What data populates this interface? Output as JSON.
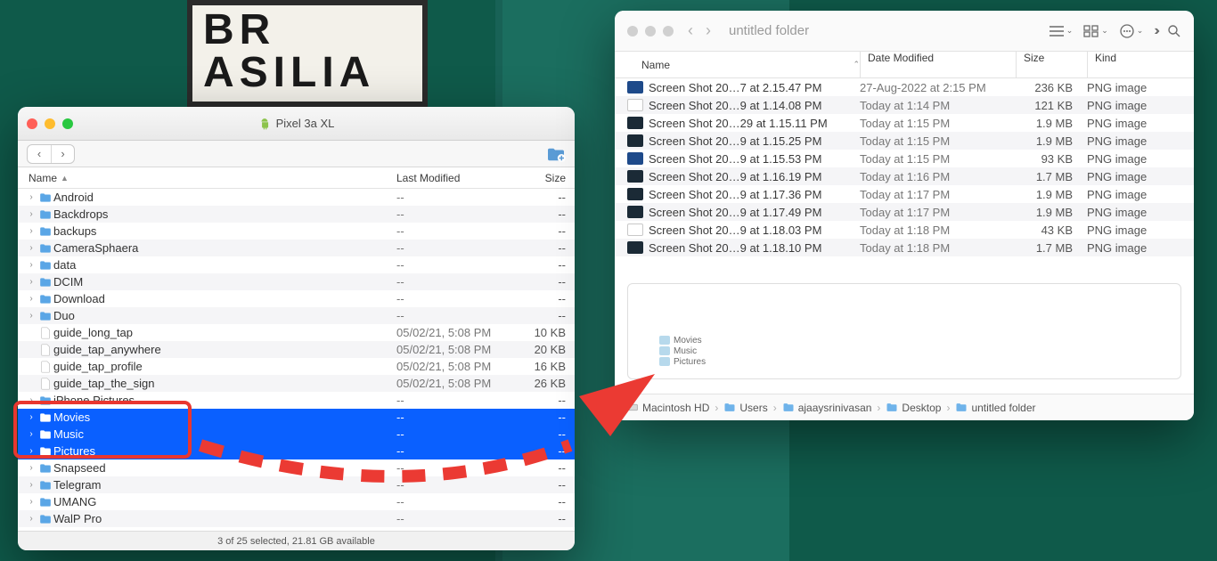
{
  "desktop": {
    "poster_text": "BR\nASILIA"
  },
  "left_window": {
    "title": "Pixel 3a XL",
    "columns": {
      "name": "Name",
      "modified": "Last Modified",
      "size": "Size"
    },
    "rows": [
      {
        "type": "folder",
        "name": "Android",
        "mod": "--",
        "size": "--",
        "sel": false
      },
      {
        "type": "folder",
        "name": "Backdrops",
        "mod": "--",
        "size": "--",
        "sel": false
      },
      {
        "type": "folder",
        "name": "backups",
        "mod": "--",
        "size": "--",
        "sel": false
      },
      {
        "type": "folder",
        "name": "CameraSphaera",
        "mod": "--",
        "size": "--",
        "sel": false
      },
      {
        "type": "folder",
        "name": "data",
        "mod": "--",
        "size": "--",
        "sel": false
      },
      {
        "type": "folder",
        "name": "DCIM",
        "mod": "--",
        "size": "--",
        "sel": false
      },
      {
        "type": "folder",
        "name": "Download",
        "mod": "--",
        "size": "--",
        "sel": false
      },
      {
        "type": "folder",
        "name": "Duo",
        "mod": "--",
        "size": "--",
        "sel": false
      },
      {
        "type": "file",
        "name": "guide_long_tap",
        "mod": "05/02/21, 5:08 PM",
        "size": "10 KB",
        "sel": false
      },
      {
        "type": "file",
        "name": "guide_tap_anywhere",
        "mod": "05/02/21, 5:08 PM",
        "size": "20 KB",
        "sel": false
      },
      {
        "type": "file",
        "name": "guide_tap_profile",
        "mod": "05/02/21, 5:08 PM",
        "size": "16 KB",
        "sel": false
      },
      {
        "type": "file",
        "name": "guide_tap_the_sign",
        "mod": "05/02/21, 5:08 PM",
        "size": "26 KB",
        "sel": false
      },
      {
        "type": "folder",
        "name": "iPhone Pictures",
        "mod": "--",
        "size": "--",
        "sel": false
      },
      {
        "type": "folder",
        "name": "Movies",
        "mod": "--",
        "size": "--",
        "sel": true
      },
      {
        "type": "folder",
        "name": "Music",
        "mod": "--",
        "size": "--",
        "sel": true
      },
      {
        "type": "folder",
        "name": "Pictures",
        "mod": "--",
        "size": "--",
        "sel": true
      },
      {
        "type": "folder",
        "name": "Snapseed",
        "mod": "--",
        "size": "--",
        "sel": false
      },
      {
        "type": "folder",
        "name": "Telegram",
        "mod": "--",
        "size": "--",
        "sel": false
      },
      {
        "type": "folder",
        "name": "UMANG",
        "mod": "--",
        "size": "--",
        "sel": false
      },
      {
        "type": "folder",
        "name": "WalP Pro",
        "mod": "--",
        "size": "--",
        "sel": false
      }
    ],
    "status": "3 of 25 selected, 21.81 GB available"
  },
  "right_window": {
    "title": "untitled folder",
    "columns": {
      "name": "Name",
      "modified": "Date Modified",
      "size": "Size",
      "kind": "Kind"
    },
    "rows": [
      {
        "thumb": "blue",
        "name": "Screen Shot 20…7 at 2.15.47 PM",
        "mod": "27-Aug-2022 at 2:15 PM",
        "size": "236 KB",
        "kind": "PNG image"
      },
      {
        "thumb": "light",
        "name": "Screen Shot 20…9 at 1.14.08 PM",
        "mod": "Today at 1:14 PM",
        "size": "121 KB",
        "kind": "PNG image"
      },
      {
        "thumb": "dark",
        "name": "Screen Shot 20…29 at 1.15.11 PM",
        "mod": "Today at 1:15 PM",
        "size": "1.9 MB",
        "kind": "PNG image"
      },
      {
        "thumb": "dark",
        "name": "Screen Shot 20…9 at 1.15.25 PM",
        "mod": "Today at 1:15 PM",
        "size": "1.9 MB",
        "kind": "PNG image"
      },
      {
        "thumb": "blue",
        "name": "Screen Shot 20…9 at 1.15.53 PM",
        "mod": "Today at 1:15 PM",
        "size": "93 KB",
        "kind": "PNG image"
      },
      {
        "thumb": "dark",
        "name": "Screen Shot 20…9 at 1.16.19 PM",
        "mod": "Today at 1:16 PM",
        "size": "1.7 MB",
        "kind": "PNG image"
      },
      {
        "thumb": "dark",
        "name": "Screen Shot 20…9 at 1.17.36 PM",
        "mod": "Today at 1:17 PM",
        "size": "1.9 MB",
        "kind": "PNG image"
      },
      {
        "thumb": "dark",
        "name": "Screen Shot 20…9 at 1.17.49 PM",
        "mod": "Today at 1:17 PM",
        "size": "1.9 MB",
        "kind": "PNG image"
      },
      {
        "thumb": "light",
        "name": "Screen Shot 20…9 at 1.18.03 PM",
        "mod": "Today at 1:18 PM",
        "size": "43 KB",
        "kind": "PNG image"
      },
      {
        "thumb": "dark",
        "name": "Screen Shot 20…9 at 1.18.10 PM",
        "mod": "Today at 1:18 PM",
        "size": "1.7 MB",
        "kind": "PNG image"
      }
    ],
    "ghost_drag": [
      "Movies",
      "Music",
      "Pictures"
    ],
    "path": [
      {
        "icon": "disk",
        "label": "Macintosh HD"
      },
      {
        "icon": "folder",
        "label": "Users"
      },
      {
        "icon": "folder",
        "label": "ajaaysrinivasan"
      },
      {
        "icon": "folder",
        "label": "Desktop"
      },
      {
        "icon": "folder",
        "label": "untitled folder"
      }
    ]
  }
}
